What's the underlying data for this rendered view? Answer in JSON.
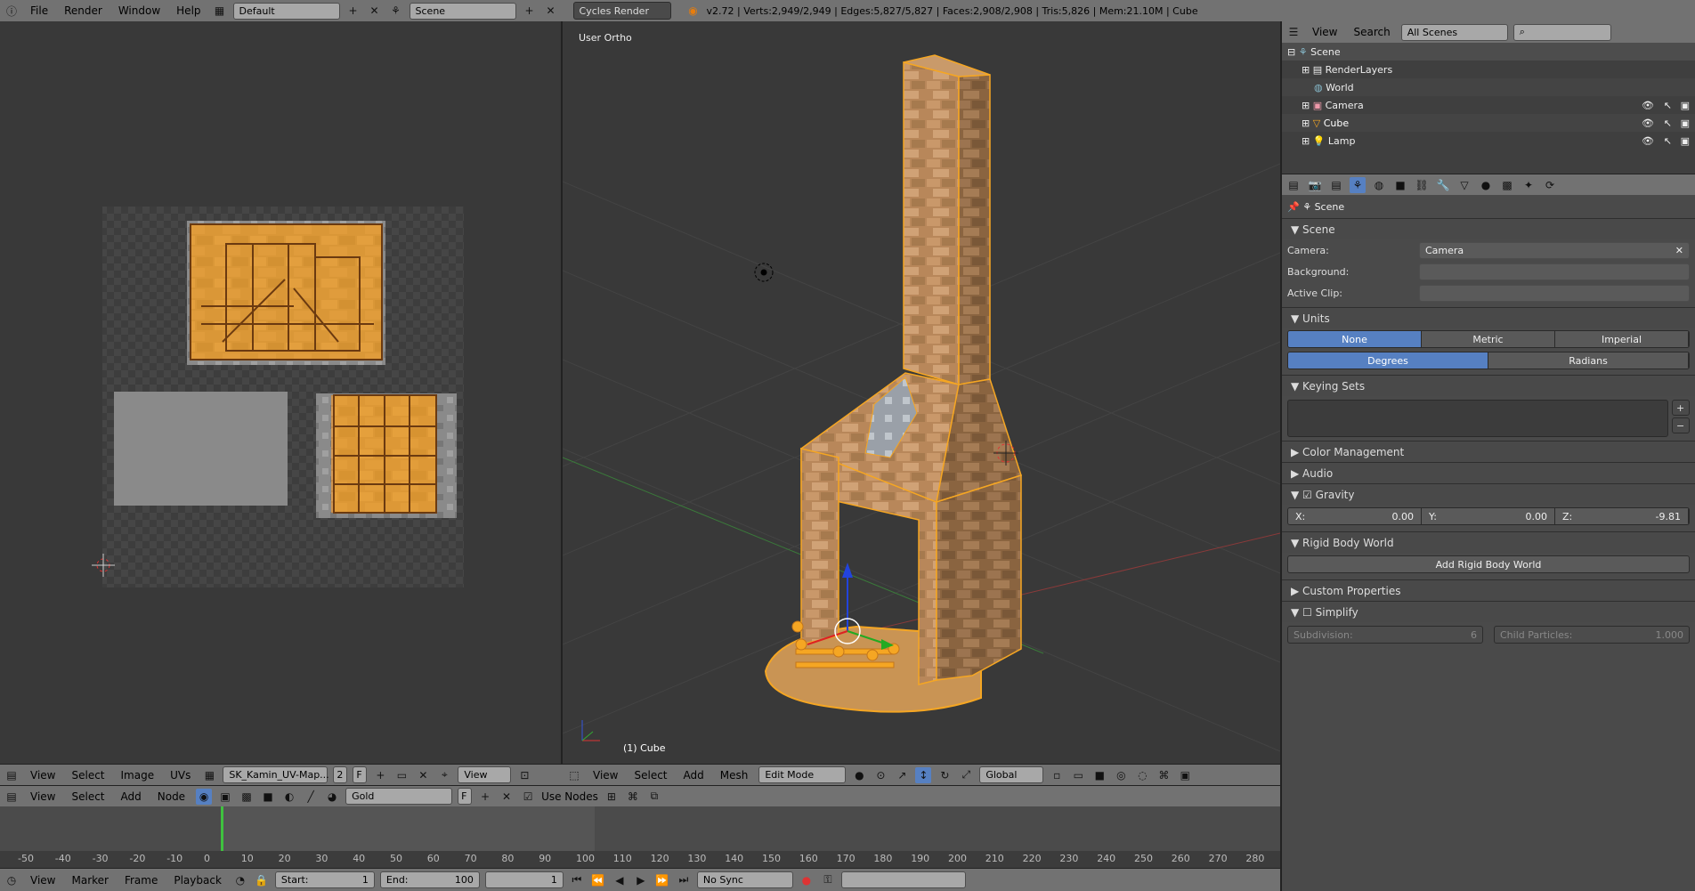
{
  "topbar": {
    "menus": [
      "File",
      "Render",
      "Window",
      "Help"
    ],
    "layout": "Default",
    "scene": "Scene",
    "engine": "Cycles Render",
    "stats": "v2.72 | Verts:2,949/2,949 | Edges:5,827/5,827 | Faces:2,908/2,908 | Tris:5,826 | Mem:21.10M | Cube"
  },
  "uv_editor": {
    "header_items": [
      "View",
      "Select",
      "Image",
      "UVs"
    ],
    "image_name": "SK_Kamin_UV-Map...",
    "users": "2",
    "fake": "F",
    "view_mode": "View"
  },
  "viewport": {
    "label": "User Ortho",
    "object_label": "(1) Cube",
    "header_items": [
      "View",
      "Select",
      "Add",
      "Mesh"
    ],
    "mode": "Edit Mode",
    "orientation": "Global"
  },
  "node_header": {
    "items": [
      "View",
      "Select",
      "Add",
      "Node"
    ],
    "material": "Gold",
    "fake": "F",
    "use_nodes": "Use Nodes"
  },
  "timeline": {
    "ticks": [
      "-50",
      "-40",
      "-30",
      "-20",
      "-10",
      "0",
      "10",
      "20",
      "30",
      "40",
      "50",
      "60",
      "70",
      "80",
      "90",
      "100",
      "110",
      "120",
      "130",
      "140",
      "150",
      "160",
      "170",
      "180",
      "190",
      "200",
      "210",
      "220",
      "230",
      "240",
      "250",
      "260",
      "270",
      "280"
    ],
    "header_items": [
      "View",
      "Marker",
      "Frame",
      "Playback"
    ],
    "start_label": "Start:",
    "start_value": "1",
    "end_label": "End:",
    "end_value": "100",
    "current": "1",
    "sync": "No Sync"
  },
  "outliner": {
    "header_items": [
      "View",
      "Search"
    ],
    "filter": "All Scenes",
    "items": [
      {
        "name": "Scene",
        "indent": 0
      },
      {
        "name": "RenderLayers",
        "indent": 1
      },
      {
        "name": "World",
        "indent": 1
      },
      {
        "name": "Camera",
        "indent": 1
      },
      {
        "name": "Cube",
        "indent": 1
      },
      {
        "name": "Lamp",
        "indent": 1
      }
    ]
  },
  "properties": {
    "context": "Scene",
    "scene_panel": {
      "title": "Scene",
      "camera_label": "Camera:",
      "camera_value": "Camera",
      "background_label": "Background:",
      "active_clip_label": "Active Clip:"
    },
    "units": {
      "title": "Units",
      "systems": [
        "None",
        "Metric",
        "Imperial"
      ],
      "rotation": [
        "Degrees",
        "Radians"
      ]
    },
    "keying_sets": "Keying Sets",
    "color_management": "Color Management",
    "audio": "Audio",
    "gravity": {
      "title": "Gravity",
      "x_label": "X:",
      "x": "0.00",
      "y_label": "Y:",
      "y": "0.00",
      "z_label": "Z:",
      "z": "-9.81"
    },
    "rigid_body": {
      "title": "Rigid Body World",
      "button": "Add Rigid Body World"
    },
    "custom_properties": "Custom Properties",
    "simplify": {
      "title": "Simplify",
      "subdivision_label": "Subdivision:",
      "subdivision": "6",
      "child_label": "Child Particles:",
      "child": "1.000"
    }
  },
  "colors": {
    "accent": "#5680c2",
    "selection": "#f5a623"
  }
}
